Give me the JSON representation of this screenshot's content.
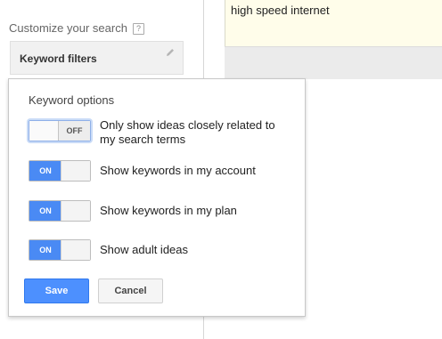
{
  "sidebar": {
    "customize_label": "Customize your search",
    "help_glyph": "?",
    "keyword_filters_label": "Keyword filters"
  },
  "search": {
    "query": "high speed internet"
  },
  "keyword_options": {
    "title": "Keyword options",
    "options": [
      {
        "label_line1": "Only show ideas closely related to",
        "label_line2": "my search terms",
        "state": "OFF"
      },
      {
        "label_line1": "Show keywords in my account",
        "state": "ON"
      },
      {
        "label_line1": "Show keywords in my plan",
        "state": "ON"
      },
      {
        "label_line1": "Show adult ideas",
        "state": "ON"
      }
    ],
    "save_label": "Save",
    "cancel_label": "Cancel"
  },
  "colors": {
    "toggle_on": "#4a8af4",
    "save_button": "#4d90fe",
    "query_background": "#fffdea"
  }
}
